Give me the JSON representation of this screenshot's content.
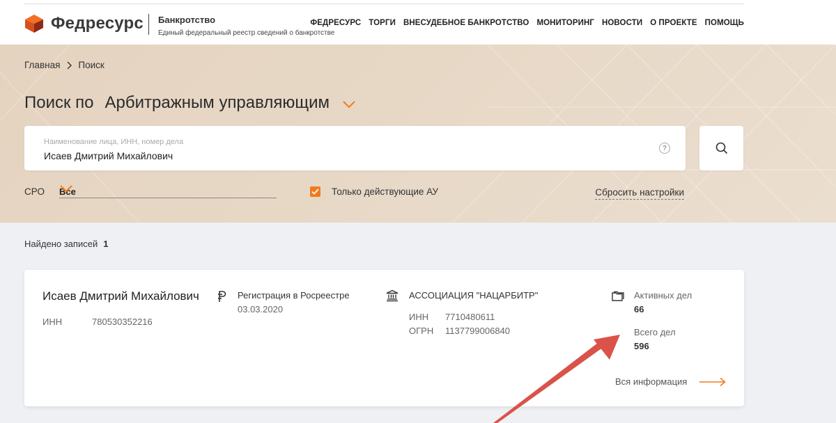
{
  "header": {
    "logo_name": "Федресурс",
    "section_title": "Банкротство",
    "section_desc": "Единый федеральный реестр сведений о банкротстве",
    "nav": [
      "ФЕДРЕСУРС",
      "ТОРГИ",
      "ВНЕСУДЕБНОЕ БАНКРОТСТВО",
      "МОНИТОРИНГ",
      "НОВОСТИ",
      "О ПРОЕКТЕ",
      "ПОМОЩЬ"
    ]
  },
  "breadcrumb": {
    "home": "Главная",
    "current": "Поиск"
  },
  "search": {
    "title_prefix": "Поиск по",
    "title_type": "Арбитражным управляющим",
    "placeholder": "Наименование лица, ИНН, номер дела",
    "value": "Исаев Дмитрий Михайлович",
    "help": "?"
  },
  "filters": {
    "sro_label": "СРО",
    "sro_value": "Все",
    "checkbox_label": "Только действующие АУ",
    "checkbox_checked": true,
    "reset": "Сбросить настройки"
  },
  "results": {
    "found_label": "Найдено записей",
    "found_count": "1",
    "card": {
      "name": "Исаев Дмитрий Михайлович",
      "inn_label": "ИНН",
      "inn_value": "780530352216",
      "reg_title": "Регистрация в Росреестре",
      "reg_date": "03.03.2020",
      "sro_name": "АССОЦИАЦИЯ \"НАЦАРБИТР\"",
      "sro_inn_label": "ИНН",
      "sro_inn_value": "7710480611",
      "sro_ogrn_label": "ОГРН",
      "sro_ogrn_value": "1137799006840",
      "active_label": "Активных дел",
      "active_value": "66",
      "total_label": "Всего дел",
      "total_value": "596",
      "more": "Вся информация"
    }
  },
  "colors": {
    "accent": "#f07a1f",
    "hero_bg": "#e4d3bf",
    "results_bg": "#eef0f3",
    "annotation": "#d9534a"
  }
}
